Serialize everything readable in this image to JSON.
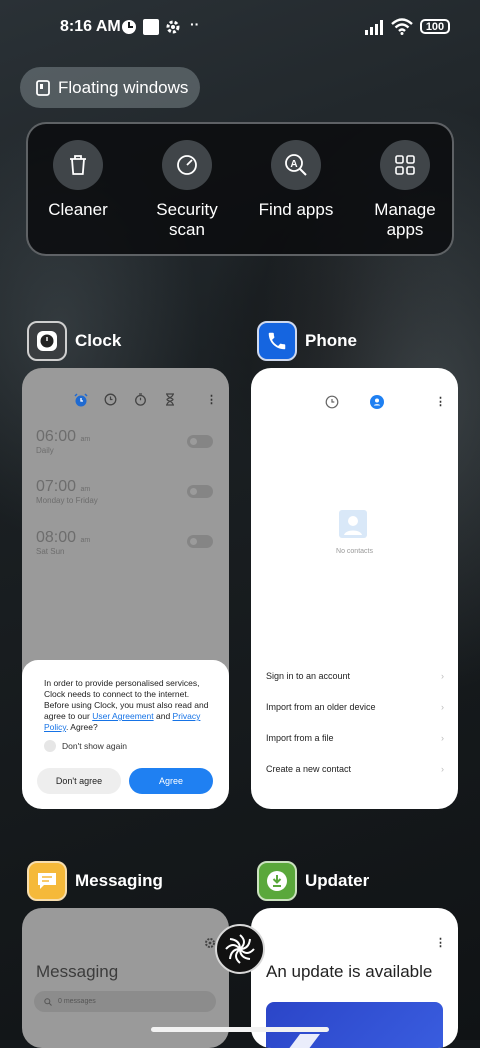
{
  "status_bar": {
    "time": "8:16 AM",
    "battery": "100"
  },
  "floating_windows": {
    "label": "Floating windows"
  },
  "tools": [
    {
      "label": "Cleaner",
      "icon": "trash-icon"
    },
    {
      "label": "Security scan",
      "icon": "security-scan-icon"
    },
    {
      "label": "Find apps",
      "icon": "find-apps-icon"
    },
    {
      "label": "Manage apps",
      "icon": "grid-icon"
    }
  ],
  "apps": {
    "clock": {
      "name": "Clock",
      "alarms": [
        {
          "time": "06:00",
          "ampm": "am",
          "days": "Daily"
        },
        {
          "time": "07:00",
          "ampm": "am",
          "days": "Monday to Friday"
        },
        {
          "time": "08:00",
          "ampm": "am",
          "days": "Sat Sun"
        }
      ],
      "dialog": {
        "text1": "In order to provide personalised services, Clock needs to connect to the internet. Before using Clock, you must also read and agree to our ",
        "link1": "User Agreement",
        "and": " and ",
        "link2": "Privacy Policy",
        "text2": ". Agree?",
        "checkbox": "Don't show again",
        "disagree": "Don't agree",
        "agree": "Agree"
      }
    },
    "phone": {
      "name": "Phone",
      "empty": "No contacts",
      "actions": [
        "Sign in to an account",
        "Import from an older device",
        "Import from a file",
        "Create a new contact"
      ]
    },
    "messaging": {
      "name": "Messaging",
      "title": "Messaging",
      "search_placeholder": "0 messages"
    },
    "updater": {
      "name": "Updater",
      "title": "An update is available"
    }
  },
  "colors": {
    "accent": "#1f80f2",
    "clock_icon_bg": "#3a3d40",
    "phone_icon_bg": "#1565e0",
    "messaging_icon_bg": "#f5b93a",
    "updater_icon_bg": "#5aa83b"
  }
}
